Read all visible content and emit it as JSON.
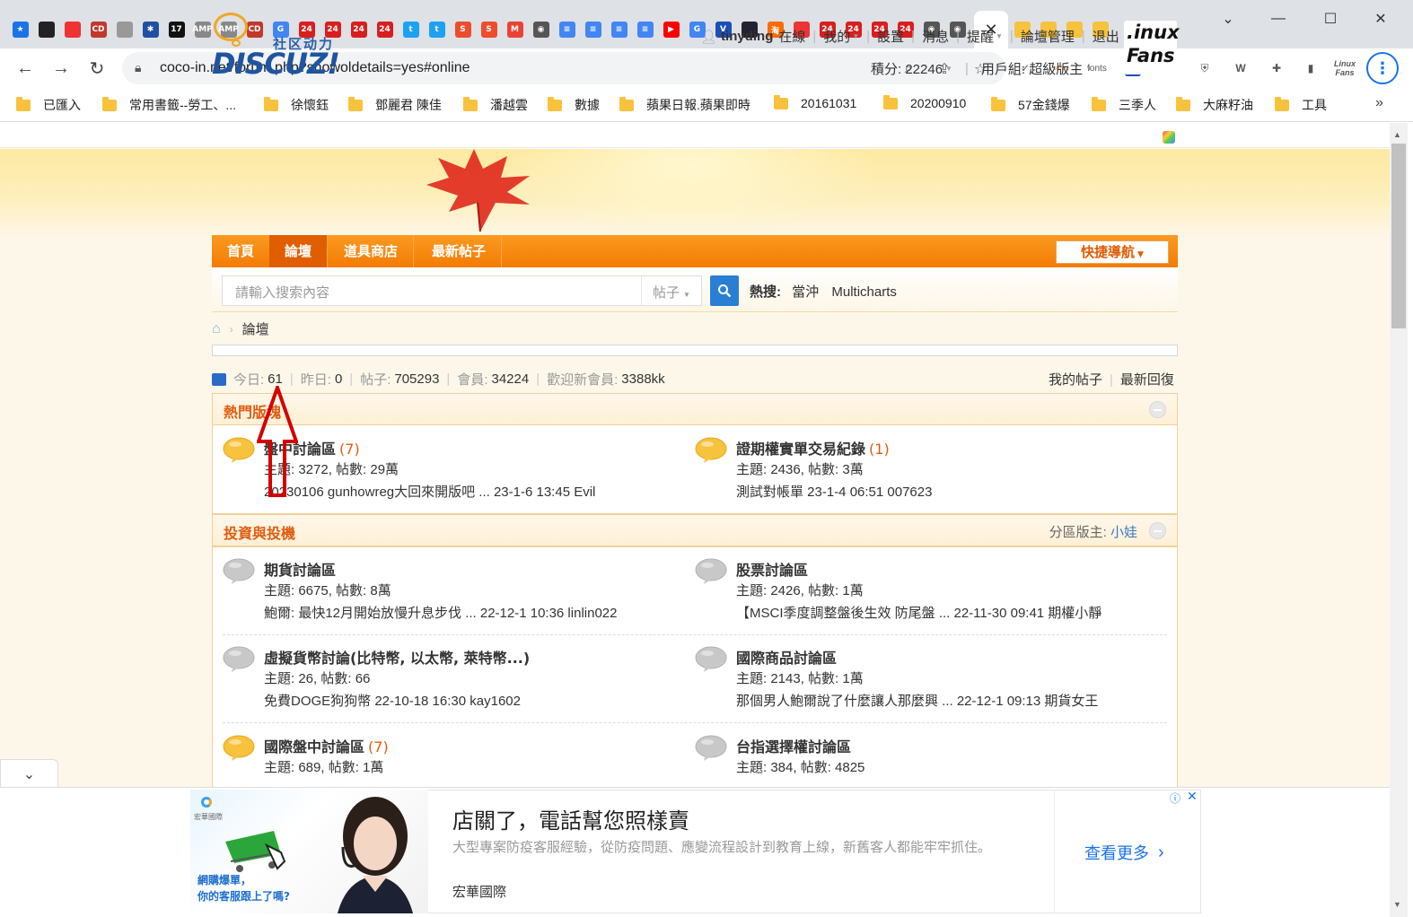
{
  "browser": {
    "tab_icons": [
      {
        "icon": "star-icon",
        "color": "#1a73e8",
        "text": "★"
      },
      {
        "icon": "app-icon",
        "color": "#222",
        "text": ""
      },
      {
        "icon": "app-icon",
        "color": "#e33",
        "text": ""
      },
      {
        "icon": "cd-icon",
        "color": "#c0392b",
        "text": "CD"
      },
      {
        "icon": "app-icon",
        "color": "#999",
        "text": ""
      },
      {
        "icon": "star-box-icon",
        "color": "#1f4fa5",
        "text": "✱"
      },
      {
        "icon": "app-icon",
        "color": "#111",
        "text": "17"
      },
      {
        "icon": "amp-icon",
        "color": "#888",
        "text": "AMP"
      },
      {
        "icon": "amp-icon",
        "color": "#888",
        "text": "AMP"
      },
      {
        "icon": "cd-icon",
        "color": "#c0392b",
        "text": "CD"
      },
      {
        "icon": "google-icon",
        "color": "#4285f4",
        "text": "G"
      },
      {
        "icon": "app-24-icon",
        "color": "#d81e1e",
        "text": "24"
      },
      {
        "icon": "app-24-icon",
        "color": "#d81e1e",
        "text": "24"
      },
      {
        "icon": "app-24-icon",
        "color": "#d81e1e",
        "text": "24"
      },
      {
        "icon": "app-24-icon",
        "color": "#d81e1e",
        "text": "24"
      },
      {
        "icon": "twitter-icon",
        "color": "#1da1f2",
        "text": "t"
      },
      {
        "icon": "twitter-icon",
        "color": "#1da1f2",
        "text": "t"
      },
      {
        "icon": "shopee-icon",
        "color": "#ee4d2d",
        "text": "S"
      },
      {
        "icon": "shopee-icon",
        "color": "#ee4d2d",
        "text": "S"
      },
      {
        "icon": "gmail-icon",
        "color": "#ea4335",
        "text": "M"
      },
      {
        "icon": "globe-icon",
        "color": "#555",
        "text": "◉"
      },
      {
        "icon": "doc-icon",
        "color": "#4285f4",
        "text": "≡"
      },
      {
        "icon": "doc-icon",
        "color": "#4285f4",
        "text": "≡"
      },
      {
        "icon": "doc-icon",
        "color": "#4285f4",
        "text": "≡"
      },
      {
        "icon": "doc-icon",
        "color": "#4285f4",
        "text": "≡"
      },
      {
        "icon": "youtube-icon",
        "color": "#ff0000",
        "text": "▶"
      },
      {
        "icon": "translate-icon",
        "color": "#4285f4",
        "text": "G"
      },
      {
        "icon": "v-icon",
        "color": "#1a4fb5",
        "text": "V"
      },
      {
        "icon": "app-icon",
        "color": "#223",
        "text": ""
      },
      {
        "icon": "taobao-icon",
        "color": "#ff6a00",
        "text": "淘"
      },
      {
        "icon": "app-icon",
        "color": "#e33",
        "text": ""
      },
      {
        "icon": "app-24-icon",
        "color": "#d81e1e",
        "text": "24"
      },
      {
        "icon": "app-24-icon",
        "color": "#d81e1e",
        "text": "24"
      },
      {
        "icon": "app-24-icon",
        "color": "#d81e1e",
        "text": "24"
      },
      {
        "icon": "app-24-icon",
        "color": "#d81e1e",
        "text": "24"
      },
      {
        "icon": "globe-icon",
        "color": "#555",
        "text": "◉"
      },
      {
        "icon": "globe-icon",
        "color": "#555",
        "text": "◉"
      },
      {
        "icon": "globe-icon",
        "color": "#555",
        "text": "◉"
      }
    ],
    "after_tab_icons": [
      {
        "icon": "discuz-icon",
        "color": "#f7c23c"
      },
      {
        "icon": "discuz-icon",
        "color": "#f7c23c"
      },
      {
        "icon": "discuz-icon",
        "color": "#f7c23c"
      },
      {
        "icon": "discuz-icon",
        "color": "#f7c23c"
      }
    ],
    "active_tab_close": "✕",
    "new_tab": "+",
    "window_controls": {
      "minimize": "⌄",
      "restore": "—",
      "maximize": "☐",
      "close": "✕"
    },
    "url": "coco-in.net/forum.php?showoldetails=yes#online",
    "extensions": [
      "fonts"
    ],
    "bookmarks": [
      "已匯入",
      "常用書籤--勞工、...",
      "徐懷鈺",
      "鄧麗君 陳佳",
      "潘越雲",
      "數據",
      "蘋果日報.蘋果即時",
      "20161031",
      "20200910",
      "57金錢爆",
      "三季人",
      "大麻籽油",
      "工具"
    ],
    "bookmarks_more": "»"
  },
  "header": {
    "logo_sub": "社区动力",
    "logo_main": "DISCUZ!",
    "user": {
      "name": "tinyding",
      "status": "在線",
      "links": [
        "我的",
        "設置",
        "消息",
        "提醒",
        "論壇管理",
        "退出"
      ]
    },
    "points_label": "積分: 22246",
    "group_label": "用戶組: 超級版主",
    "badge_line1": ".inux",
    "badge_line2": "Fans"
  },
  "nav": {
    "items": [
      "首頁",
      "論壇",
      "道具商店",
      "最新帖子"
    ],
    "active": "論壇",
    "quick_nav": "快捷導航"
  },
  "search": {
    "placeholder": "請輸入搜索內容",
    "scope": "帖子",
    "hot_label": "熱搜:",
    "hot_terms": [
      "當沖",
      "Multicharts"
    ]
  },
  "breadcrumb": {
    "current": "論壇"
  },
  "stats": {
    "today_label": "今日:",
    "today": "61",
    "yesterday_label": "昨日:",
    "yesterday": "0",
    "posts_label": "帖子:",
    "posts": "705293",
    "members_label": "會員:",
    "members": "34224",
    "newest_label": "歡迎新會員:",
    "newest": "3388kk",
    "my_posts": "我的帖子",
    "latest_replies": "最新回復"
  },
  "categories": [
    {
      "title": "熱門版塊",
      "moderator_label": "",
      "moderator": "",
      "forums": [
        {
          "name": "盤中討論區",
          "new_count": "(7)",
          "stats": "主題: 3272, 帖數: 29萬",
          "last": "20230106 gunhowreg大回來開版吧 ... 23-1-6 13:45 Evil",
          "has_new": true
        },
        {
          "name": "證期權實單交易紀錄",
          "new_count": "(1)",
          "stats": "主題: 2436, 帖數: 3萬",
          "last": "測試對帳單 23-1-4 06:51 007623",
          "has_new": true
        }
      ]
    },
    {
      "title": "投資與投機",
      "moderator_label": "分區版主:",
      "moderator": "小娃",
      "forums": [
        {
          "name": "期貨討論區",
          "new_count": "",
          "stats": "主題: 6675, 帖數: 8萬",
          "last": "鮑爾: 最快12月開始放慢升息步伐 ... 22-12-1 10:36 linlin022",
          "has_new": false
        },
        {
          "name": "股票討論區",
          "new_count": "",
          "stats": "主題: 2426, 帖數: 1萬",
          "last": "【MSCI季度調整盤後生效 防尾盤 ... 22-11-30 09:41 期權小靜",
          "has_new": false
        },
        {
          "name": "虛擬貨幣討論(比特幣, 以太幣, 萊特幣...)",
          "new_count": "",
          "stats": "主題: 26, 帖數: 66",
          "last": "免費DOGE狗狗幣 22-10-18 16:30 kay1602",
          "has_new": false
        },
        {
          "name": "國際商品討論區",
          "new_count": "",
          "stats": "主題: 2143, 帖數: 1萬",
          "last": "那個男人鮑爾說了什麼讓人那麼興 ... 22-12-1 09:13 期貨女王",
          "has_new": false
        },
        {
          "name": "國際盤中討論區",
          "new_count": "(7)",
          "stats": "主題: 689, 帖數: 1萬",
          "last": "",
          "has_new": true
        },
        {
          "name": "台指選擇權討論區",
          "new_count": "",
          "stats": "主題: 384, 帖數: 4825",
          "last": "",
          "has_new": false
        }
      ]
    }
  ],
  "ad": {
    "headline": "店關了，電話幫您照樣賣",
    "body": "大型專案防疫客服經驗，從防疫問題、應變流程設計到教育上線，新舊客人都能牢牢抓住。",
    "brand": "宏華國際",
    "cta": "查看更多",
    "small_logo_text": "宏華國際",
    "caption_line1": "網購爆單，",
    "caption_line2": "你的客服跟上了嗎?"
  },
  "colors": {
    "nav_orange": "#f37b05",
    "accent_red": "#e05c10",
    "link_blue": "#3a78c4",
    "new_bubble": "#f7c23c",
    "old_bubble": "#c8c8c8",
    "annotation_arrow": "#d40000"
  }
}
